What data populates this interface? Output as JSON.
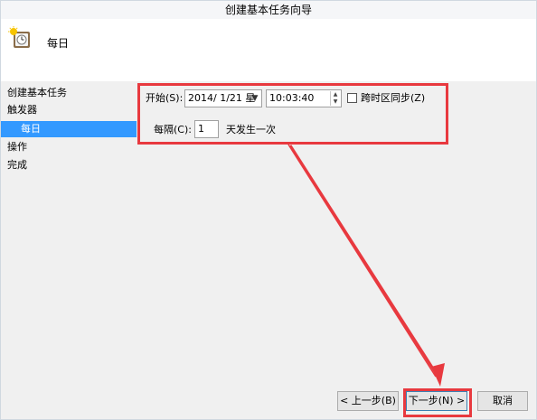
{
  "window": {
    "title": "创建基本任务向导"
  },
  "header": {
    "title": "每日",
    "icon": "task-clock-icon"
  },
  "sidebar": {
    "items": [
      {
        "label": "创建基本任务",
        "level": "main",
        "selected": false
      },
      {
        "label": "触发器",
        "level": "main",
        "selected": false
      },
      {
        "label": "每日",
        "level": "sub",
        "selected": true
      },
      {
        "label": "操作",
        "level": "main",
        "selected": false
      },
      {
        "label": "完成",
        "level": "main",
        "selected": false
      }
    ]
  },
  "form": {
    "start_label": "开始(S):",
    "date_value": "2014/  1/21 星",
    "time_value": "10:03:40",
    "sync_label": "跨时区同步(Z)",
    "sync_checked": false,
    "recur_label": "每隔(C):",
    "recur_value": "1",
    "recur_unit": "天发生一次"
  },
  "buttons": {
    "back": "< 上一步(B)",
    "next": "下一步(N) >",
    "cancel": "取消"
  },
  "colors": {
    "highlight": "#e8393f",
    "selection": "#3399ff"
  }
}
